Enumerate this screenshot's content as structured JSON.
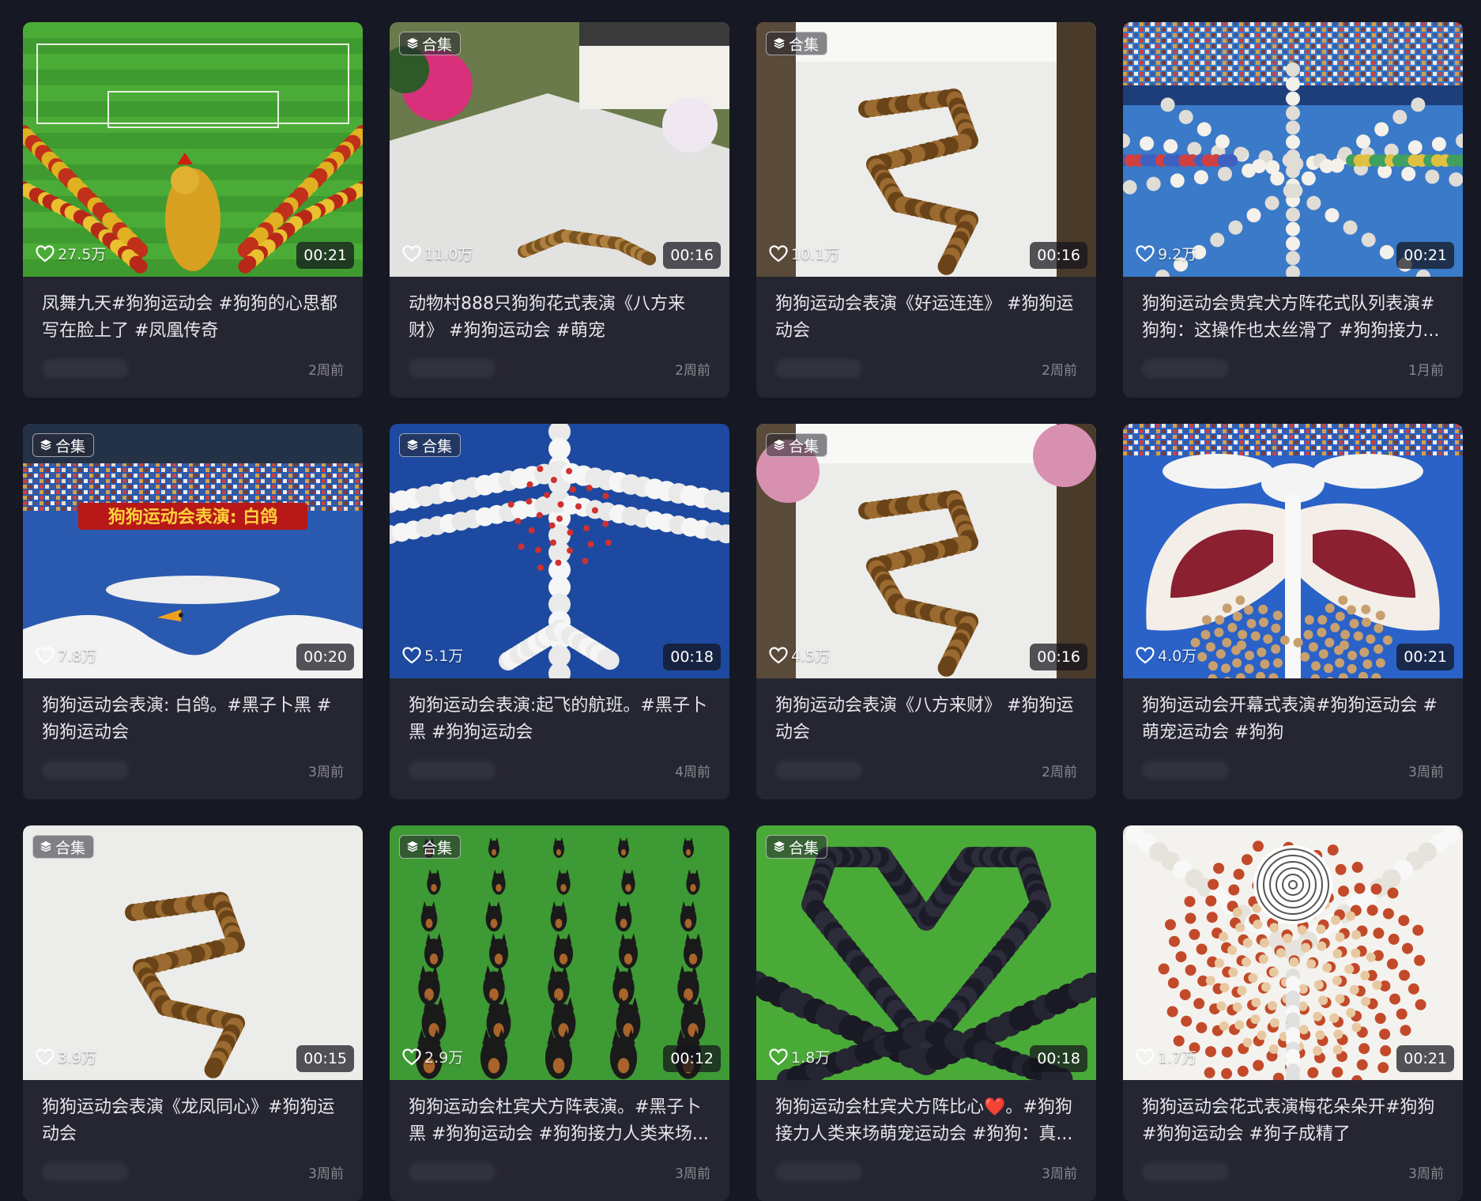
{
  "collection_label": "合集",
  "icons": {
    "collection": "stack-icon",
    "like": "heart-outline-icon"
  },
  "cards": [
    {
      "title": "凤舞九天#狗狗运动会 #狗狗的心思都写在脸上了 #凤凰传奇",
      "likes": "27.5万",
      "duration": "00:21",
      "time": "2周前",
      "collection": false,
      "art": "phoenix"
    },
    {
      "title": "动物村888只狗狗花式表演《八方来财》 #狗狗运动会 #萌宠",
      "likes": "11.0万",
      "duration": "00:16",
      "time": "2周前",
      "collection": true,
      "art": "courtyard"
    },
    {
      "title": "狗狗运动会表演《好运连连》 #狗狗运动会",
      "likes": "10.1万",
      "duration": "00:16",
      "time": "2周前",
      "collection": true,
      "art": "snake"
    },
    {
      "title": "狗狗运动会贵宾犬方阵花式队列表演#狗狗：这操作也太丝滑了 #狗狗接力...",
      "likes": "9.2万",
      "duration": "00:21",
      "time": "1月前",
      "collection": false,
      "art": "poodle-star"
    },
    {
      "title": "狗狗运动会表演: 白鸽。#黑子卜黑 #狗狗运动会",
      "likes": "7.8万",
      "duration": "00:20",
      "time": "3周前",
      "collection": true,
      "art": "dove",
      "banner": "狗狗运动会表演: 白鸽"
    },
    {
      "title": "狗狗运动会表演:起飞的航班。#黑子卜黑 #狗狗运动会",
      "likes": "5.1万",
      "duration": "00:18",
      "time": "4周前",
      "collection": true,
      "art": "plane"
    },
    {
      "title": "狗狗运动会表演《八方来财》 #狗狗运动会",
      "likes": "4.5万",
      "duration": "00:16",
      "time": "2周前",
      "collection": true,
      "art": "snake2"
    },
    {
      "title": "狗狗运动会开幕式表演#狗狗运动会 #萌宠运动会 #狗狗",
      "likes": "4.0万",
      "duration": "00:21",
      "time": "3周前",
      "collection": false,
      "art": "butterfly"
    },
    {
      "title": "狗狗运动会表演《龙凤同心》#狗狗运动会",
      "likes": "3.9万",
      "duration": "00:15",
      "time": "3周前",
      "collection": true,
      "art": "snake3"
    },
    {
      "title": "狗狗运动会杜宾犬方阵表演。#黑子卜黑 #狗狗运动会 #狗狗接力人类来场...",
      "likes": "2.9万",
      "duration": "00:12",
      "time": "3周前",
      "collection": true,
      "art": "doberman"
    },
    {
      "title": "狗狗运动会杜宾犬方阵比心❤️。#狗狗接力人类来场萌宠运动会 #狗狗：真...",
      "likes": "1.8万",
      "duration": "00:18",
      "time": "3周前",
      "collection": true,
      "art": "heart"
    },
    {
      "title": "狗狗运动会花式表演梅花朵朵开#狗狗 #狗狗运动会 #狗子成精了",
      "likes": "1.7万",
      "duration": "00:21",
      "time": "3周前",
      "collection": false,
      "art": "flower"
    }
  ]
}
